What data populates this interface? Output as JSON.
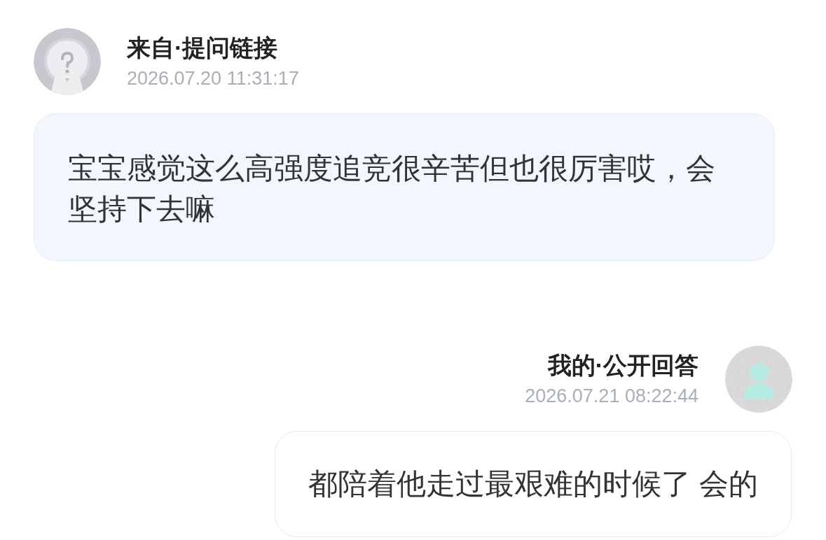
{
  "messages": [
    {
      "kind": "question",
      "sender": "来自·提问链接",
      "time": "2026.07.20 11:31:17",
      "text": "宝宝感觉这么高强度追竞很辛苦但也很厉害哎，会坚持下去嘛"
    },
    {
      "kind": "answer",
      "sender": "我的·公开回答",
      "time": "2026.07.21 08:22:44",
      "text": "都陪着他走过最艰难的时候了 会的"
    }
  ]
}
